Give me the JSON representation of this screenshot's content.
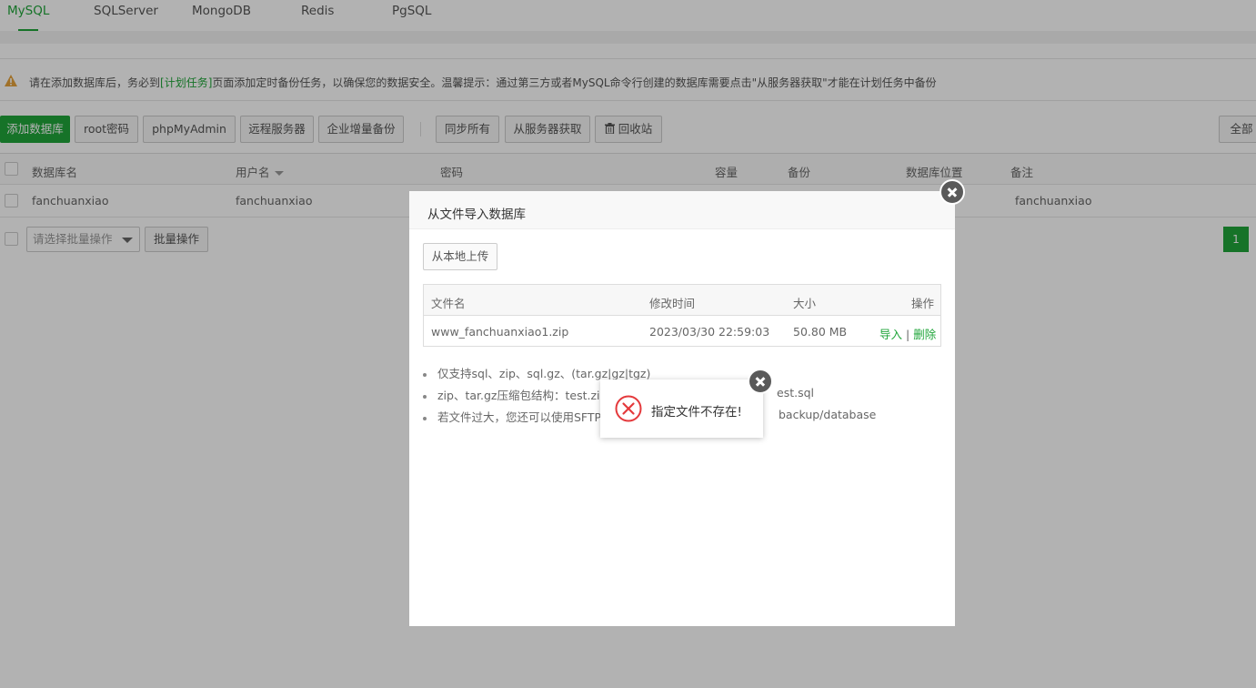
{
  "tabs": [
    "MySQL",
    "SQLServer",
    "MongoDB",
    "Redis",
    "PgSQL"
  ],
  "notice": {
    "before": "请在添加数据库后，务必到",
    "link": "[计划任务]",
    "after": "页面添加定时备份任务，以确保您的数据安全。温馨提示：通过第三方或者MySQL命令行创建的数据库需要点击\"从服务器获取\"才能在计划任务中备份"
  },
  "toolbar": {
    "add_db": "添加数据库",
    "root_pwd": "root密码",
    "phpmyadmin": "phpMyAdmin",
    "remote": "远程服务器",
    "enterprise_backup": "企业增量备份",
    "sync_all": "同步所有",
    "fetch_server": "从服务器获取",
    "recycle": "回收站",
    "all": "全部"
  },
  "table": {
    "headers": {
      "name": "数据库名",
      "user": "用户名",
      "password": "密码",
      "capacity": "容量",
      "backup": "备份",
      "location": "数据库位置",
      "note": "备注"
    },
    "rows": [
      {
        "name": "fanchuanxiao",
        "user": "fanchuanxiao",
        "note": "fanchuanxiao"
      }
    ]
  },
  "batch": {
    "select_placeholder": "请选择批量操作",
    "button": "批量操作",
    "page": "1"
  },
  "modal": {
    "title": "从文件导入数据库",
    "upload": "从本地上传",
    "headers": {
      "file": "文件名",
      "mtime": "修改时间",
      "size": "大小",
      "ops": "操作"
    },
    "files": [
      {
        "name": "www_fanchuanxiao1.zip",
        "mtime": "2023/03/30 22:59:03",
        "size": "50.80 MB",
        "import": "导入",
        "sep": "|",
        "delete": "删除"
      }
    ],
    "tips": [
      "仅支持sql、zip、sql.gz、(tar.gz|gz|tgz)",
      "zip、tar.gz压缩包结构：test.zip或",
      "若文件过大，您还可以使用SFTP工"
    ],
    "tip_tails": [
      "",
      "est.sql",
      "backup/database"
    ]
  },
  "alert": {
    "message": "指定文件不存在!"
  },
  "colors": {
    "accent": "#20a53a",
    "error": "#e4393c",
    "warning": "#e6a23c"
  }
}
